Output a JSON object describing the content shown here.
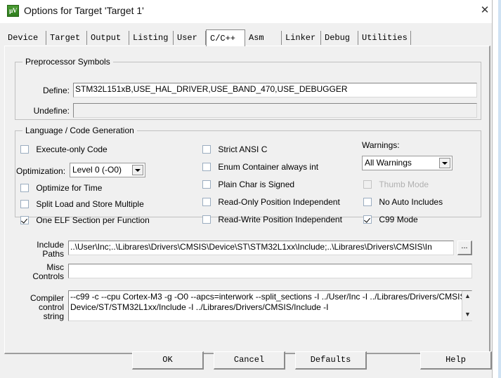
{
  "window": {
    "title": "Options for Target 'Target 1'",
    "icon": "uvision-logo-icon",
    "close_label": "✕"
  },
  "tabs": [
    {
      "label": "Device",
      "active": false
    },
    {
      "label": "Target",
      "active": false
    },
    {
      "label": "Output",
      "active": false
    },
    {
      "label": "Listing",
      "active": false
    },
    {
      "label": "User",
      "active": false
    },
    {
      "label": "C/C++",
      "active": true
    },
    {
      "label": "Asm",
      "active": false
    },
    {
      "label": "Linker",
      "active": false
    },
    {
      "label": "Debug",
      "active": false
    },
    {
      "label": "Utilities",
      "active": false
    }
  ],
  "preprocessor": {
    "group_title": "Preprocessor Symbols",
    "define_label": "Define:",
    "define_value": "STM32L151xB,USE_HAL_DRIVER,USE_BAND_470,USE_DEBUGGER",
    "undefine_label": "Undefine:",
    "undefine_value": ""
  },
  "language": {
    "group_title": "Language / Code Generation",
    "left_checks": [
      {
        "label": "Execute-only Code",
        "checked": false,
        "disabled": false
      },
      {
        "label": "Optimize for Time",
        "checked": false,
        "disabled": false
      },
      {
        "label": "Split Load and Store Multiple",
        "checked": false,
        "disabled": false
      },
      {
        "label": "One ELF Section per Function",
        "checked": true,
        "disabled": false
      }
    ],
    "optimization_label": "Optimization:",
    "optimization_value": "Level 0 (-O0)",
    "middle_checks": [
      {
        "label": "Strict ANSI C",
        "checked": false,
        "disabled": false
      },
      {
        "label": "Enum Container always int",
        "checked": false,
        "disabled": false
      },
      {
        "label": "Plain Char is Signed",
        "checked": false,
        "disabled": false
      },
      {
        "label": "Read-Only Position Independent",
        "checked": false,
        "disabled": false
      },
      {
        "label": "Read-Write Position Independent",
        "checked": false,
        "disabled": false
      }
    ],
    "warnings_label": "Warnings:",
    "warnings_value": "All Warnings",
    "right_checks": [
      {
        "label": "Thumb Mode",
        "checked": false,
        "disabled": true
      },
      {
        "label": "No Auto Includes",
        "checked": false,
        "disabled": false
      },
      {
        "label": "C99 Mode",
        "checked": true,
        "disabled": false
      }
    ]
  },
  "paths": {
    "include_label_line1": "Include",
    "include_label_line2": "Paths",
    "include_value": "..\\User\\Inc;..\\Librares\\Drivers\\CMSIS\\Device\\ST\\STM32L1xx\\Include;..\\Librares\\Drivers\\CMSIS\\In",
    "browse_label": "...",
    "misc_label_line1": "Misc",
    "misc_label_line2": "Controls",
    "misc_value": "",
    "compiler_label_line1": "Compiler",
    "compiler_label_line2": "control",
    "compiler_label_line3": "string",
    "compiler_value": "--c99 -c --cpu Cortex-M3 -g -O0 --apcs=interwork --split_sections -I ../User/Inc -I ../Librares/Drivers/CMSIS/Device/ST/STM32L1xx/Include -I ../Librares/Drivers/CMSIS/Include -I",
    "scroll_up": "▲",
    "scroll_down": "▼"
  },
  "buttons": {
    "ok": "OK",
    "cancel": "Cancel",
    "defaults": "Defaults",
    "help": "Help"
  },
  "colors": {
    "dialog_bg": "#f0f0f0",
    "field_bg": "#ffffff",
    "group_border": "#c0c0c0",
    "accent_edge": "#cfe2f3",
    "icon_green": "#2e7d1e"
  }
}
